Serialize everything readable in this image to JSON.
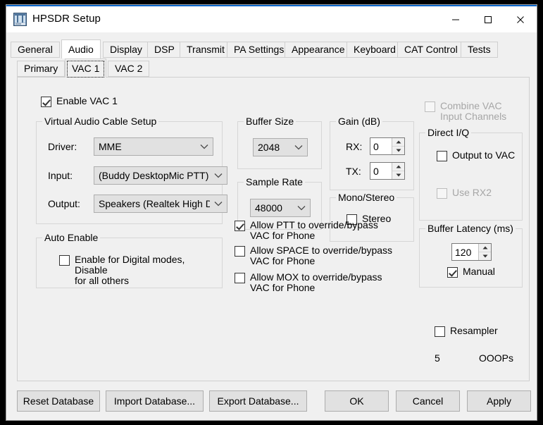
{
  "window": {
    "title": "HPSDR Setup",
    "icon": "app-window-icon",
    "controls": {
      "minimize": "minimize-icon",
      "maximize": "maximize-icon",
      "close": "close-icon"
    }
  },
  "tabs": {
    "items": [
      {
        "label": "General",
        "active": false
      },
      {
        "label": "Audio",
        "active": true
      },
      {
        "label": "Display",
        "active": false
      },
      {
        "label": "DSP",
        "active": false
      },
      {
        "label": "Transmit",
        "active": false
      },
      {
        "label": "PA Settings",
        "active": false
      },
      {
        "label": "Appearance",
        "active": false
      },
      {
        "label": "Keyboard",
        "active": false
      },
      {
        "label": "CAT Control",
        "active": false
      },
      {
        "label": "Tests",
        "active": false
      }
    ]
  },
  "subtabs": {
    "items": [
      {
        "label": "Primary",
        "active": false
      },
      {
        "label": "VAC 1",
        "active": true,
        "focused": true
      },
      {
        "label": "VAC 2",
        "active": false
      }
    ]
  },
  "enable_vac": {
    "label": "Enable VAC 1",
    "checked": true
  },
  "vac_setup": {
    "title": "Virtual Audio Cable Setup",
    "driver": {
      "label": "Driver:",
      "value": "MME"
    },
    "input": {
      "label": "Input:",
      "value": "(Buddy DesktopMic PTT)"
    },
    "output": {
      "label": "Output:",
      "value": "Speakers (Realtek High Defi"
    }
  },
  "auto_enable": {
    "title": "Auto Enable",
    "checkbox": {
      "label": "Enable for Digital modes, Disable\nfor all others",
      "checked": false
    }
  },
  "buffer_size": {
    "title": "Buffer Size",
    "value": "2048"
  },
  "sample_rate": {
    "title": "Sample Rate",
    "value": "48000"
  },
  "gain": {
    "title": "Gain (dB)",
    "rx": {
      "label": "RX:",
      "value": "0"
    },
    "tx": {
      "label": "TX:",
      "value": "0"
    }
  },
  "mono_stereo": {
    "title": "Mono/Stereo",
    "stereo": {
      "label": "Stereo",
      "checked": false
    }
  },
  "overrides": [
    {
      "label": "Allow PTT to override/bypass\nVAC for Phone",
      "checked": true
    },
    {
      "label": "Allow SPACE to override/bypass\nVAC for Phone",
      "checked": false
    },
    {
      "label": "Allow MOX to override/bypass\nVAC for Phone",
      "checked": false
    }
  ],
  "combine_vac": {
    "label": "Combine VAC\nInput Channels",
    "checked": false,
    "disabled": true
  },
  "direct_iq": {
    "title": "Direct I/Q",
    "output_to_vac": {
      "label": "Output to VAC",
      "checked": false,
      "disabled": false
    },
    "use_rx2": {
      "label": "Use RX2",
      "checked": false,
      "disabled": true
    }
  },
  "buffer_latency": {
    "title": "Buffer Latency (ms)",
    "value": "120",
    "manual": {
      "label": "Manual",
      "checked": true
    }
  },
  "resampler": {
    "label": "Resampler",
    "checked": false
  },
  "status": {
    "count": "5",
    "ooops": "OOOPs"
  },
  "buttons": {
    "reset_database": "Reset Database",
    "import_database": "Import Database...",
    "export_database": "Export Database...",
    "ok": "OK",
    "cancel": "Cancel",
    "apply": "Apply"
  }
}
